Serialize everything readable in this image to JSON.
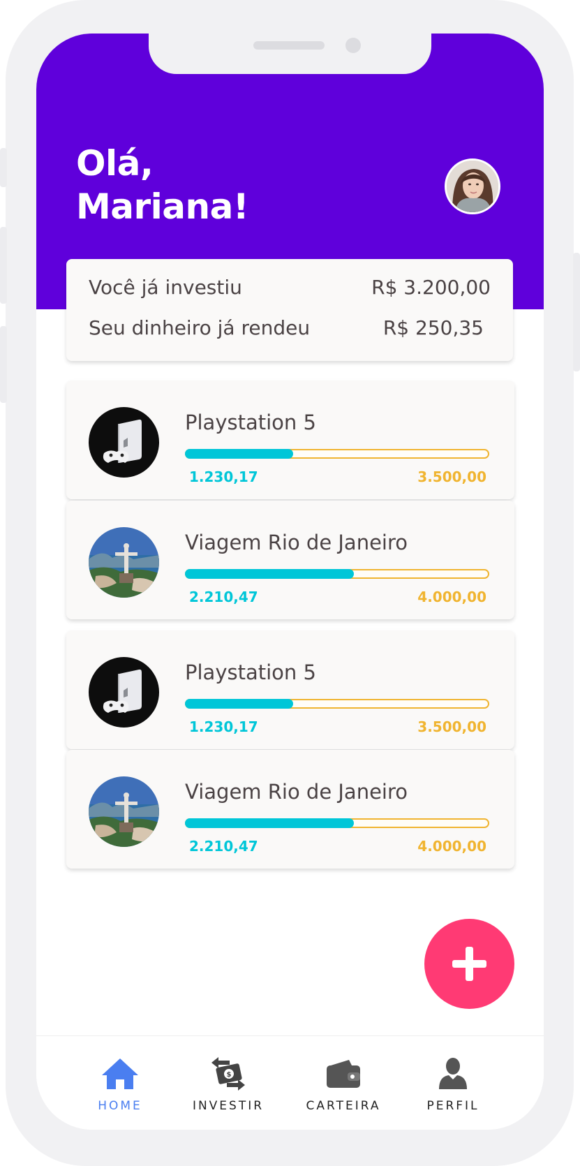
{
  "header": {
    "greeting_line1": "Olá,",
    "greeting_line2": "Mariana!"
  },
  "summary": {
    "invested_label": "Você já investiu",
    "invested_value": "R$ 3.200,00",
    "earned_label": "Seu dinheiro já rendeu",
    "earned_value": "R$ 250,35"
  },
  "goals": [
    {
      "title": "Playstation 5",
      "saved": "1.230,17",
      "target": "3.500,00",
      "progress": 0.35,
      "image": "playstation-5-image"
    },
    {
      "title": "Viagem Rio de Janeiro",
      "saved": "2.210,47",
      "target": "4.000,00",
      "progress": 0.55,
      "image": "rio-de-janeiro-image"
    },
    {
      "title": "Playstation 5",
      "saved": "1.230,17",
      "target": "3.500,00",
      "progress": 0.35,
      "image": "playstation-5-image"
    },
    {
      "title": "Viagem Rio de Janeiro",
      "saved": "2.210,47",
      "target": "4.000,00",
      "progress": 0.55,
      "image": "rio-de-janeiro-image"
    }
  ],
  "nav": [
    {
      "label": "HOME",
      "icon": "home-icon",
      "active": true
    },
    {
      "label": "INVESTIR",
      "icon": "money-transfer-icon",
      "active": false
    },
    {
      "label": "CARTEIRA",
      "icon": "wallet-icon",
      "active": false
    },
    {
      "label": "PERFIL",
      "icon": "user-icon",
      "active": false
    }
  ],
  "colors": {
    "header": "#5f00db",
    "progress_fill": "#00c6d8",
    "goal_text": "#f0b430",
    "fab": "#ff3a74",
    "nav_active": "#4a7ef0"
  }
}
